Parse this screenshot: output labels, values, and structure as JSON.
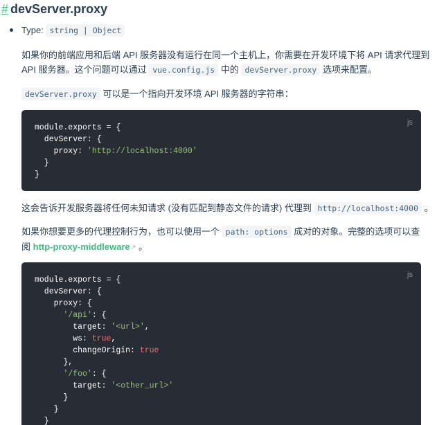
{
  "heading": {
    "anchor": "#",
    "title": "devServer.proxy"
  },
  "type_line": {
    "label": "Type:",
    "value": "string | Object"
  },
  "para1": {
    "line1": "如果你的前端应用和后端 API 服务器没有运行在同一个主机上，你需要在开发环境下将 API 请求代理到",
    "line2_pre": "API 服务器。这个问题可以通过",
    "code1": "vue.config.js",
    "mid": "中的",
    "code2": "devServer.proxy",
    "post": "选项来配置。"
  },
  "para2": {
    "code": "devServer.proxy",
    "text": "可以是一个指向开发环境 API 服务器的字符串："
  },
  "code1": {
    "lang": "js",
    "lines": [
      [
        {
          "t": "module.exports = {",
          "c": "plain"
        }
      ],
      [
        {
          "t": "  devServer: {",
          "c": "plain"
        }
      ],
      [
        {
          "t": "    proxy: ",
          "c": "plain"
        },
        {
          "t": "'http://localhost:4000'",
          "c": "str"
        }
      ],
      [
        {
          "t": "  }",
          "c": "plain"
        }
      ],
      [
        {
          "t": "}",
          "c": "plain"
        }
      ]
    ]
  },
  "para3": {
    "text": "这会告诉开发服务器将任何未知请求 (没有匹配到静态文件的请求) 代理到",
    "code": "http://localhost:4000",
    "post": "。"
  },
  "para4": {
    "line1_pre": "如果你想要更多的代理控制行为，也可以使用一个",
    "code": "path: options",
    "line1_post": "成对的对象。完整的选项可以查",
    "line2_pre": "阅",
    "link": "http-proxy-middleware",
    "link_icon": "external-link-icon",
    "line2_post": "。"
  },
  "code2": {
    "lang": "js",
    "lines": [
      [
        {
          "t": "module.exports = {",
          "c": "plain"
        }
      ],
      [
        {
          "t": "  devServer: {",
          "c": "plain"
        }
      ],
      [
        {
          "t": "    proxy: {",
          "c": "plain"
        }
      ],
      [
        {
          "t": "      ",
          "c": "plain"
        },
        {
          "t": "'/api'",
          "c": "str"
        },
        {
          "t": ": {",
          "c": "plain"
        }
      ],
      [
        {
          "t": "        target: ",
          "c": "plain"
        },
        {
          "t": "'<url>'",
          "c": "str"
        },
        {
          "t": ",",
          "c": "plain"
        }
      ],
      [
        {
          "t": "        ws: ",
          "c": "plain"
        },
        {
          "t": "true",
          "c": "lit"
        },
        {
          "t": ",",
          "c": "plain"
        }
      ],
      [
        {
          "t": "        changeOrigin: ",
          "c": "plain"
        },
        {
          "t": "true",
          "c": "lit"
        }
      ],
      [
        {
          "t": "      },",
          "c": "plain"
        }
      ],
      [
        {
          "t": "      ",
          "c": "plain"
        },
        {
          "t": "'/foo'",
          "c": "str"
        },
        {
          "t": ": {",
          "c": "plain"
        }
      ],
      [
        {
          "t": "        target: ",
          "c": "plain"
        },
        {
          "t": "'<other_url>'",
          "c": "str"
        }
      ],
      [
        {
          "t": "      }",
          "c": "plain"
        }
      ],
      [
        {
          "t": "    }",
          "c": "plain"
        }
      ],
      [
        {
          "t": "  }",
          "c": "plain"
        }
      ]
    ]
  }
}
